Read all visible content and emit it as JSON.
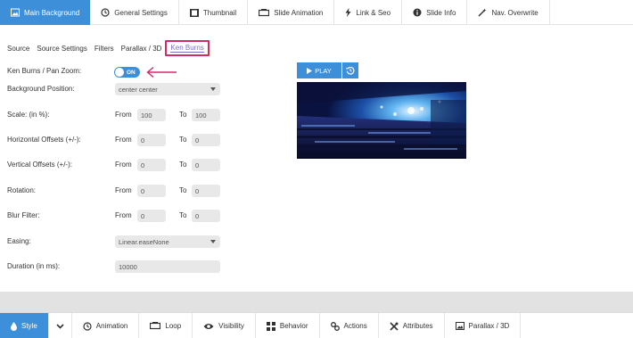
{
  "top_tabs": [
    {
      "label": "Main Background",
      "icon": "image-icon",
      "active": true
    },
    {
      "label": "General Settings",
      "icon": "history-icon"
    },
    {
      "label": "Thumbnail",
      "icon": "film-icon"
    },
    {
      "label": "Slide Animation",
      "icon": "slides-icon"
    },
    {
      "label": "Link & Seo",
      "icon": "link-icon"
    },
    {
      "label": "Slide Info",
      "icon": "info-icon"
    },
    {
      "label": "Nav. Overwrite",
      "icon": "wand-icon"
    }
  ],
  "sub_tabs": [
    {
      "label": "Source"
    },
    {
      "label": "Source Settings"
    },
    {
      "label": "Filters"
    },
    {
      "label": "Parallax / 3D"
    },
    {
      "label": "Ken Burns",
      "active": true
    }
  ],
  "form": {
    "ken_burns_label": "Ken Burns / Pan Zoom:",
    "toggle_text": "ON",
    "bg_position_label": "Background Position:",
    "bg_position_value": "center center",
    "scale_label": "Scale: (in %):",
    "scale_from": "100",
    "scale_to": "100",
    "h_offsets_label": "Horizontal Offsets (+/-):",
    "h_from": "0",
    "h_to": "0",
    "v_offsets_label": "Vertical Offsets (+/-):",
    "v_from": "0",
    "v_to": "0",
    "rotation_label": "Rotation:",
    "rot_from": "0",
    "rot_to": "0",
    "blur_label": "Blur Filter:",
    "blur_from": "0",
    "blur_to": "0",
    "easing_label": "Easing:",
    "easing_value": "Linear.easeNone",
    "duration_label": "Duration (in ms):",
    "duration_value": "10000",
    "from_label": "From",
    "to_label": "To"
  },
  "preview": {
    "play_label": "PLAY"
  },
  "bottom_tabs": [
    {
      "label": "Style",
      "icon": "drop-icon",
      "active": true
    },
    {
      "label": "",
      "icon": "chevron-down-icon"
    },
    {
      "label": "Animation",
      "icon": "history-icon"
    },
    {
      "label": "Loop",
      "icon": "loop-icon"
    },
    {
      "label": "Visibility",
      "icon": "eye-icon"
    },
    {
      "label": "Behavior",
      "icon": "behavior-icon"
    },
    {
      "label": "Actions",
      "icon": "link-icon"
    },
    {
      "label": "Attributes",
      "icon": "tools-icon"
    },
    {
      "label": "Parallax / 3D",
      "icon": "image-icon"
    }
  ],
  "colors": {
    "accent": "#3d8fd9",
    "highlight": "#d12a6a",
    "active_subtab_text": "#7a6fd0"
  }
}
